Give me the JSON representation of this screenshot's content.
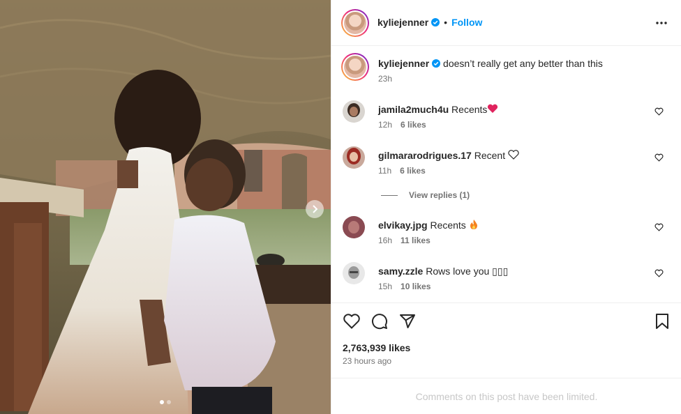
{
  "post": {
    "author": "kyliejenner",
    "follow_label": "Follow",
    "separator": "•",
    "caption": "doesn’t really get any better than this",
    "caption_time": "23h"
  },
  "comments": [
    {
      "user": "jamila2much4u",
      "text": "Recents",
      "emoji": "red-heart",
      "time": "12h",
      "likes": "6 likes"
    },
    {
      "user": "gilmararodrigues.17",
      "text": "Recent",
      "emoji": "white-heart",
      "time": "11h",
      "likes": "6 likes"
    },
    {
      "user": "elvikay.jpg",
      "text": "Recents",
      "emoji": "fire",
      "time": "16h",
      "likes": "11 likes"
    },
    {
      "user": "samy.zzle",
      "text": "Rows love you ▯▯▯",
      "emoji": "",
      "time": "15h",
      "likes": "10 likes"
    }
  ],
  "view_replies": "View replies (1)",
  "stats": {
    "likes": "2,763,939 likes",
    "posted": "23 hours ago"
  },
  "limited_notice": "Comments on this post have been limited.",
  "carousel": {
    "current": 1,
    "total": 2
  },
  "colors": {
    "link": "#0095f6",
    "text": "#262626",
    "muted": "#737373",
    "heart": "#ed4956"
  }
}
